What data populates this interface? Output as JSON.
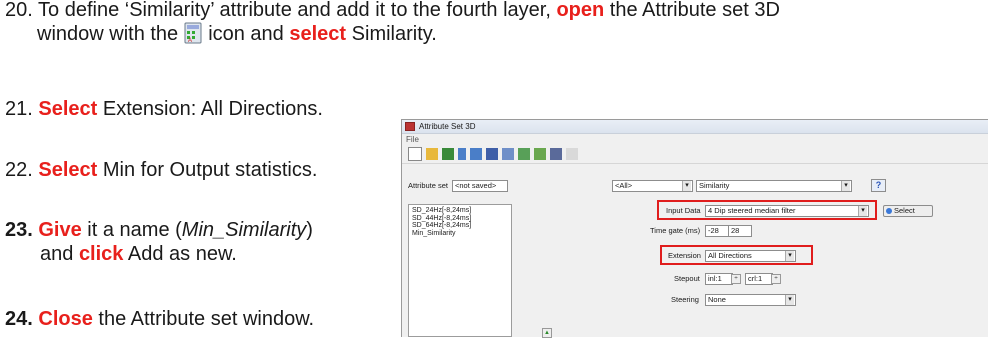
{
  "step20": {
    "num": "20.",
    "pre": "To define ‘Similarity’ attribute and add it to the fourth layer,",
    "open": "open",
    "mid": "the Attribute set 3D",
    "line2a": "window with the",
    "line2b": "icon and",
    "select": "select",
    "end": "Similarity."
  },
  "step21": {
    "num": "21.",
    "action": "Select",
    "text": "Extension: All Directions."
  },
  "step22": {
    "num": "22.",
    "action": "Select",
    "text": "Min for Output statistics."
  },
  "step23": {
    "num": "23.",
    "action": "Give",
    "pre": "it a name (",
    "name": "Min_Similarity",
    "post": ")",
    "line2a": "and",
    "action2": "click",
    "line2b": "Add as new."
  },
  "step24": {
    "num": "24.",
    "action": "Close",
    "text": "the Attribute set window."
  },
  "window": {
    "title": "Attribute Set 3D",
    "menu_file": "File",
    "attr_set_label": "Attribute set",
    "attr_set_value": "<not saved>",
    "filter_value": "<All>",
    "attr_type_value": "Similarity",
    "help": "?",
    "attributes": [
      "SD_24Hz[-8,24ms]",
      "SD_44Hz[-8,24ms]",
      "SD_64Hz[-8,24ms]",
      "Min_Similarity"
    ],
    "input_data_label": "Input Data",
    "input_data_value": "4 Dip steered median filter",
    "select_button": "Select",
    "time_gate_label": "Time gate (ms)",
    "time_gate_start": "-28",
    "time_gate_end": "28",
    "extension_label": "Extension",
    "extension_value": "All Directions",
    "stepout_label": "Stepout",
    "stepout_inl": "inl:1",
    "stepout_crl": "crl:1",
    "steering_label": "Steering",
    "steering_value": "None"
  },
  "colors": {
    "accent_red": "#e8201c",
    "highlight_box": "#e01d1d"
  }
}
